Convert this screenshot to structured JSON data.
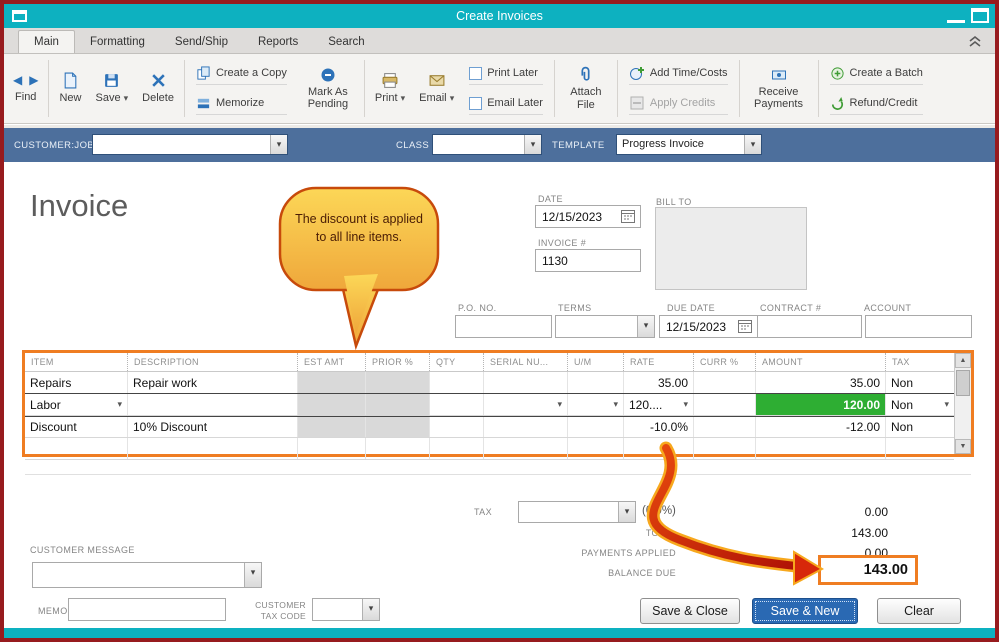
{
  "window": {
    "title": "Create Invoices"
  },
  "tabs": {
    "items": [
      "Main",
      "Formatting",
      "Send/Ship",
      "Reports",
      "Search"
    ]
  },
  "toolbar": {
    "find": "Find",
    "new": "New",
    "save": "Save",
    "delete": "Delete",
    "create_a_copy": "Create a Copy",
    "memorize": "Memorize",
    "mark_as_pending": "Mark As Pending",
    "print": "Print",
    "email": "Email",
    "print_later": "Print Later",
    "email_later": "Email Later",
    "attach_file": "Attach File",
    "add_time_costs": "Add Time/Costs",
    "apply_credits": "Apply Credits",
    "receive_payments": "Receive Payments",
    "create_a_batch": "Create a Batch",
    "refund_credit": "Refund/Credit"
  },
  "formbar": {
    "customer_job_label": "CUSTOMER:JOB",
    "class_label": "CLASS",
    "template_label": "TEMPLATE",
    "template_value": "Progress Invoice"
  },
  "invoice": {
    "title": "Invoice",
    "date_label": "DATE",
    "date_value": "12/15/2023",
    "invoice_no_label": "INVOICE #",
    "invoice_no_value": "1130",
    "bill_to_label": "BILL TO",
    "po_no_label": "P.O. NO.",
    "terms_label": "TERMS",
    "due_date_label": "DUE DATE",
    "due_date_value": "12/15/2023",
    "contract_label": "CONTRACT #",
    "account_label": "ACCOUNT"
  },
  "callout": {
    "text": "The discount is applied to all line items."
  },
  "table": {
    "columns": [
      "ITEM",
      "DESCRIPTION",
      "EST AMT",
      "PRIOR %",
      "QTY",
      "SERIAL NU...",
      "U/M",
      "RATE",
      "CURR %",
      "AMOUNT",
      "TAX"
    ],
    "rows": [
      {
        "item": "Repairs",
        "description": "Repair work",
        "rate": "35.00",
        "amount": "35.00",
        "tax": "Non"
      },
      {
        "item": "Labor",
        "description": "",
        "rate": "120....",
        "amount": "120.00",
        "tax": "Non"
      },
      {
        "item": "Discount",
        "description": "10% Discount",
        "rate": "-10.0%",
        "amount": "-12.00",
        "tax": "Non"
      }
    ]
  },
  "totals": {
    "tax_label": "TAX",
    "tax_rate": "(0.0%)",
    "tax_amount": "0.00",
    "total_label": "TOTAL",
    "total_amount": "143.00",
    "payments_applied_label": "PAYMENTS APPLIED",
    "payments_applied_amount": "0.00",
    "balance_due_label": "BALANCE DUE",
    "balance_due_amount": "143.00"
  },
  "footer": {
    "customer_message_label": "CUSTOMER MESSAGE",
    "memo_label": "MEMO",
    "customer_tax_code_label": "CUSTOMER TAX CODE",
    "save_close": "Save & Close",
    "save_new": "Save & New",
    "clear": "Clear"
  },
  "colors": {
    "titlebar_teal": "#0db1c0",
    "frame_red": "#971b1e",
    "highlight_orange": "#ef7d22",
    "selected_green": "#2eae33",
    "formbar_blue": "#4d6f9c",
    "primary_button_blue": "#2a69b3"
  }
}
